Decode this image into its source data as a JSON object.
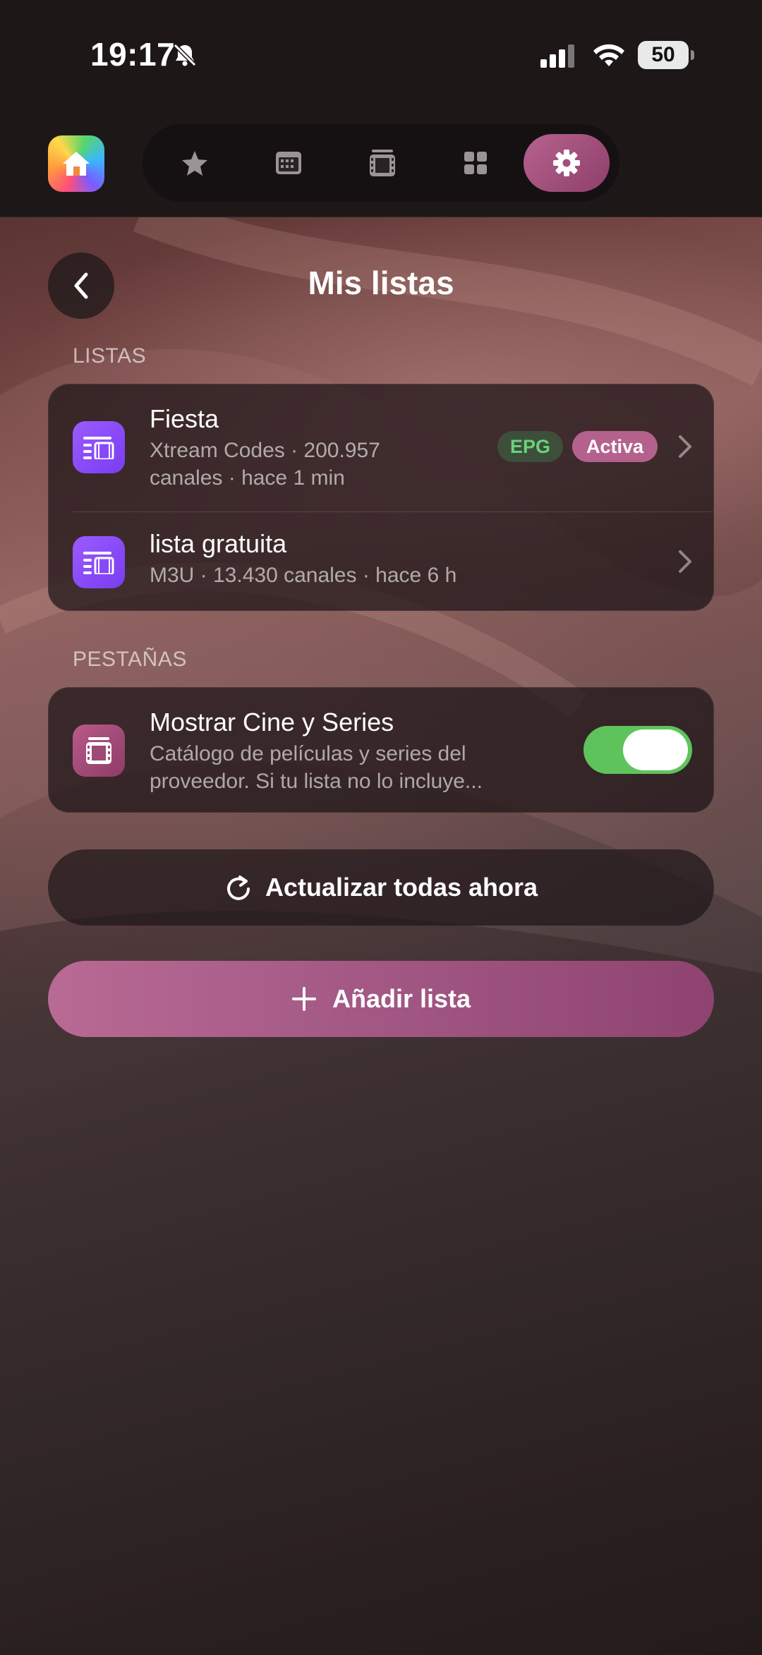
{
  "status_bar": {
    "time": "19:17",
    "battery": "50",
    "icons": [
      "bell-slash-icon",
      "signal-icon",
      "wifi-icon",
      "battery-icon"
    ]
  },
  "nav": {
    "items": [
      {
        "name": "favorites",
        "icon": "star-icon"
      },
      {
        "name": "guide",
        "icon": "calendar-grid-icon"
      },
      {
        "name": "cinema",
        "icon": "film-icon"
      },
      {
        "name": "grid",
        "icon": "grid-icon"
      },
      {
        "name": "settings",
        "icon": "gear-icon",
        "active": true
      }
    ]
  },
  "header": {
    "title": "Mis listas"
  },
  "sections": {
    "lists_label": "LISTAS",
    "tabs_label": "PESTAÑAS"
  },
  "lists": [
    {
      "title": "Fiesta",
      "sub_line1": "Xtream Codes · 200.957",
      "sub_line2": "canales · hace 1 min",
      "badge_epg": "EPG",
      "badge_active": "Activa"
    },
    {
      "title": "lista gratuita",
      "sub_line1": "M3U · 13.430 canales · hace 6 h"
    }
  ],
  "tabs_setting": {
    "title": "Mostrar Cine y Series",
    "desc_line1": "Catálogo de películas y series del",
    "desc_line2": "proveedor. Si tu lista no lo incluye...",
    "enabled": true
  },
  "buttons": {
    "refresh_label": "Actualizar todas ahora",
    "add_label": "Añadir lista"
  },
  "colors": {
    "accent": "#b4628d",
    "toggle_on": "#5fc35c",
    "epg_text": "#68d37c",
    "list_icon": "#8a4cf7"
  }
}
